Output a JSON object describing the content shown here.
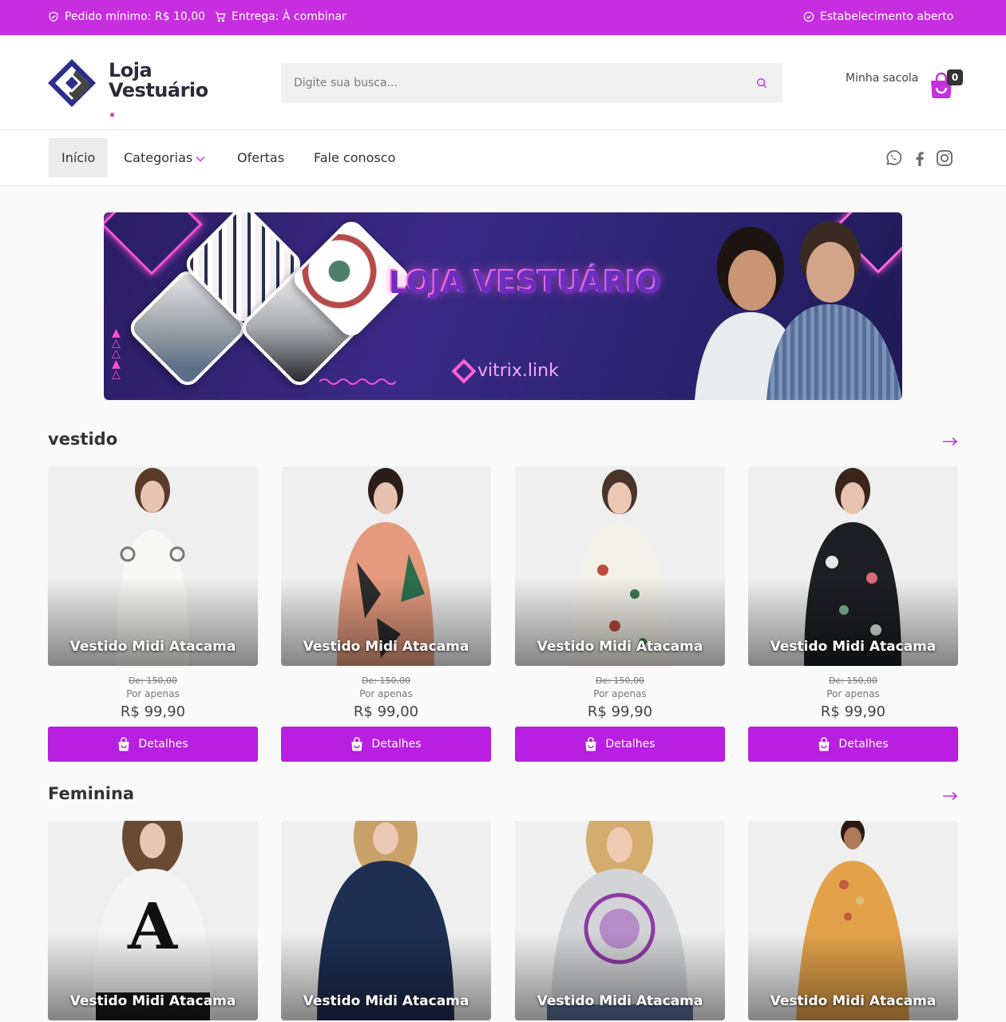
{
  "topbar": {
    "min_order": "Pedido mínimo: R$ 10,00",
    "delivery": "Entrega: À combinar",
    "status": "Estabelecimento aberto"
  },
  "header": {
    "logo_line1": "Loja",
    "logo_line2": "Vestuário",
    "logo_dot": ".",
    "search_placeholder": "Digite sua busca...",
    "bag_label": "Minha sacola",
    "bag_count": "0"
  },
  "nav": {
    "items": [
      "Início",
      "Categorias",
      "Ofertas",
      "Fale conosco"
    ],
    "social_icons": [
      "whatsapp-icon",
      "facebook-icon",
      "instagram-icon"
    ]
  },
  "banner": {
    "title": "LOJA VESTUÁRIO",
    "brand": "vitrix.link"
  },
  "sections": [
    {
      "title": "vestido",
      "products": [
        {
          "name": "Vestido Midi Atacama",
          "old_price": "De: 150,00",
          "label": "Por apenas",
          "price": "R$ 99,90",
          "button": "Detalhes"
        },
        {
          "name": "Vestido Midi Atacama",
          "old_price": "De: 150,00",
          "label": "Por apenas",
          "price": "R$ 99,00",
          "button": "Detalhes"
        },
        {
          "name": "Vestido Midi Atacama",
          "old_price": "De: 150,00",
          "label": "Por apenas",
          "price": "R$ 99,90",
          "button": "Detalhes"
        },
        {
          "name": "Vestido Midi Atacama",
          "old_price": "De: 150,00",
          "label": "Por apenas",
          "price": "R$ 99,90",
          "button": "Detalhes"
        }
      ]
    },
    {
      "title": "Feminina",
      "products": [
        {
          "name": "Vestido Midi Atacama"
        },
        {
          "name": "Vestido Midi Atacama"
        },
        {
          "name": "Vestido Midi Atacama"
        },
        {
          "name": "Vestido Midi Atacama"
        }
      ]
    }
  ],
  "colors": {
    "accent": "#c72ee0",
    "button": "#b81fe0",
    "dark": "#333333"
  }
}
